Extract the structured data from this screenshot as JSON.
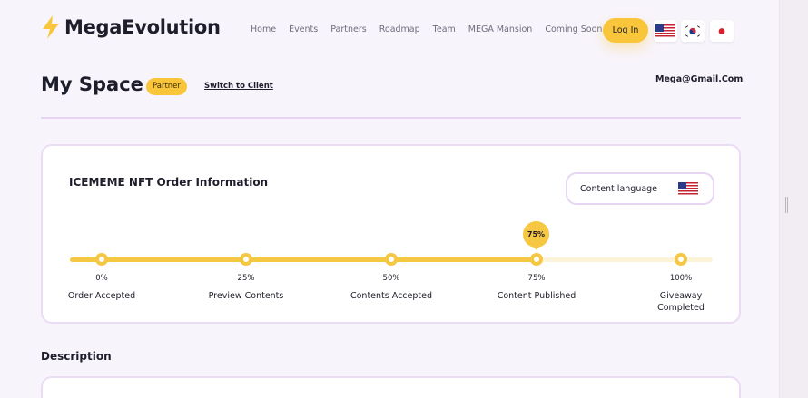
{
  "header": {
    "brand": "MegaEvolution",
    "nav": [
      "Home",
      "Events",
      "Partners",
      "Roadmap",
      "Team",
      "MEGA Mansion",
      "Coming Soon"
    ],
    "login_label": "Log In",
    "flags": [
      "us-flag-icon",
      "korea-flag-icon",
      "japan-flag-icon"
    ]
  },
  "page": {
    "title": "My Space",
    "badge": "Partner",
    "switch_link": "Switch to Client",
    "email": "Mega@Gmail.Com"
  },
  "order": {
    "title": "ICEMEME NFT Order Information",
    "content_language_label": "Content language",
    "content_language_flag": "us-flag-icon",
    "progress_percent": 75,
    "progress_bubble": "75%",
    "steps": [
      {
        "pct": "0%",
        "label": "Order Accepted"
      },
      {
        "pct": "25%",
        "label": "Preview Contents"
      },
      {
        "pct": "50%",
        "label": "Contents Accepted"
      },
      {
        "pct": "75%",
        "label": "Content Published"
      },
      {
        "pct": "100%",
        "label": "Giveaway Completed"
      }
    ]
  },
  "description": {
    "heading": "Description"
  },
  "colors": {
    "accent": "#f5c743",
    "card_border": "#eadcf5",
    "background": "#f8f4fb"
  }
}
